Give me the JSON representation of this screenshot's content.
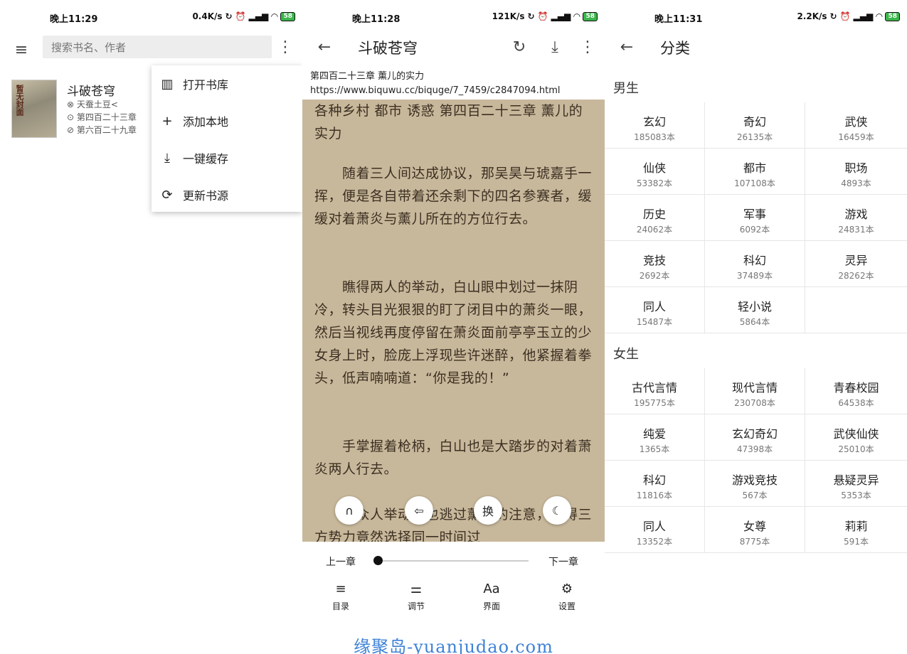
{
  "panels": [
    {
      "status": {
        "time": "晚上11:29",
        "net": "0.4K/s",
        "battery": "58"
      },
      "search": {
        "placeholder": "搜索书名、作者"
      },
      "book": {
        "cover_text": "暂无封面",
        "title": "斗破苍穹",
        "author": "⊗ 天蚕土豆<",
        "read_chapter": "⊙ 第四百二十三章",
        "latest_chapter": "⊘ 第六百二十九章"
      },
      "menu": [
        {
          "icon": "bookshelf-icon",
          "label": "打开书库"
        },
        {
          "icon": "plus-icon",
          "label": "添加本地"
        },
        {
          "icon": "download-icon",
          "label": "一键缓存"
        },
        {
          "icon": "refresh-icon",
          "label": "更新书源"
        }
      ]
    },
    {
      "status": {
        "time": "晚上11:28",
        "net": "121K/s",
        "battery": "58"
      },
      "title": "斗破苍穹",
      "chapter_title": "第四百二十三章 薰儿的实力",
      "chapter_url": "https://www.biquwu.cc/biquge/7_7459/c2847094.html",
      "paragraphs": [
        "各种乡村 都市 诱惑 第四百二十三章 薰儿的实力",
        "　　随着三人间达成协议，那吴昊与琥嘉手一挥，便是各自带着还余剩下的四名参赛者，缓缓对着萧炎与薰儿所在的方位行去。",
        "　　瞧得两人的举动，白山眼中划过一抹阴冷，转头目光狠狠的盯了闭目中的萧炎一眼，然后当视线再度停留在萧炎面前亭亭玉立的少女身上时，脸庞上浮现些许迷醉，他紧握着拳头，低声喃喃道：“你是我的！”",
        "　　手掌握着枪柄，白山也是大踏步的对着萧炎两人行去。",
        "　　中众人举动，也逃过薰儿的注意，瞧得三方势力竟然选择同一时间过"
      ],
      "fabs": [
        {
          "icon": "headphones-icon",
          "glyph": "∩"
        },
        {
          "icon": "source-switch-icon",
          "glyph": "⇦"
        },
        {
          "icon": "swap-icon",
          "glyph": "换"
        },
        {
          "icon": "night-mode-icon",
          "glyph": "☾"
        }
      ],
      "prev_label": "上一章",
      "next_label": "下一章",
      "progress": 0.0,
      "tools": [
        {
          "icon": "list-icon",
          "glyph": "≡",
          "label": "目录"
        },
        {
          "icon": "tune-icon",
          "glyph": "⚌",
          "label": "调节"
        },
        {
          "icon": "font-icon",
          "glyph": "Aa",
          "label": "界面"
        },
        {
          "icon": "gear-icon",
          "glyph": "⚙",
          "label": "设置"
        }
      ],
      "watermark": "缘聚岛-yuanjudao.com"
    },
    {
      "status": {
        "time": "晚上11:31",
        "net": "2.2K/s",
        "battery": "58"
      },
      "title": "分类",
      "male_label": "男生",
      "male": [
        {
          "name": "玄幻",
          "count": "185083本"
        },
        {
          "name": "奇幻",
          "count": "26135本"
        },
        {
          "name": "武侠",
          "count": "16459本"
        },
        {
          "name": "仙侠",
          "count": "53382本"
        },
        {
          "name": "都市",
          "count": "107108本"
        },
        {
          "name": "职场",
          "count": "4893本"
        },
        {
          "name": "历史",
          "count": "24062本"
        },
        {
          "name": "军事",
          "count": "6092本"
        },
        {
          "name": "游戏",
          "count": "24831本"
        },
        {
          "name": "竞技",
          "count": "2692本"
        },
        {
          "name": "科幻",
          "count": "37489本"
        },
        {
          "name": "灵异",
          "count": "28262本"
        },
        {
          "name": "同人",
          "count": "15487本"
        },
        {
          "name": "轻小说",
          "count": "5864本"
        },
        {
          "name": "",
          "count": ""
        }
      ],
      "female_label": "女生",
      "female": [
        {
          "name": "古代言情",
          "count": "195775本"
        },
        {
          "name": "现代言情",
          "count": "230708本"
        },
        {
          "name": "青春校园",
          "count": "64538本"
        },
        {
          "name": "纯爱",
          "count": "1365本"
        },
        {
          "name": "玄幻奇幻",
          "count": "47398本"
        },
        {
          "name": "武侠仙侠",
          "count": "25010本"
        },
        {
          "name": "科幻",
          "count": "11816本"
        },
        {
          "name": "游戏竞技",
          "count": "567本"
        },
        {
          "name": "悬疑灵异",
          "count": "5353本"
        },
        {
          "name": "同人",
          "count": "13352本"
        },
        {
          "name": "女尊",
          "count": "8775本"
        },
        {
          "name": "莉莉",
          "count": "591本"
        }
      ]
    }
  ]
}
